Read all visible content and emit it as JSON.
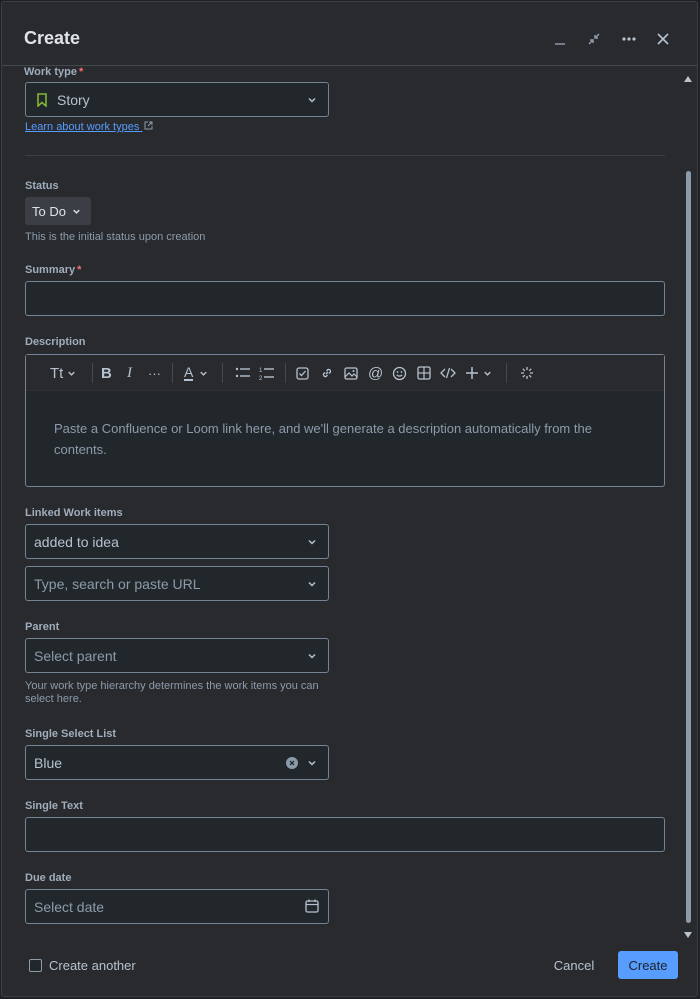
{
  "dialog": {
    "title": "Create",
    "header_icons": [
      "minimize-icon",
      "collapse-icon",
      "more-icon",
      "close-icon"
    ]
  },
  "work_type": {
    "label": "Work type",
    "required": "*",
    "value": "Story",
    "icon": "bookmark-icon",
    "icon_color": "#82b536",
    "learn_link": "Learn about work types"
  },
  "status": {
    "label": "Status",
    "value": "To Do",
    "helper": "This is the initial status upon creation"
  },
  "summary": {
    "label": "Summary",
    "required": "*",
    "value": ""
  },
  "description": {
    "label": "Description",
    "toolbar": {
      "text_style": "Tt",
      "more": "···",
      "text_color": "A"
    },
    "placeholder": "Paste a Confluence or Loom link here, and we'll generate a description automatically from the contents."
  },
  "linked_work_items": {
    "label": "Linked Work items",
    "relation": "added to idea",
    "search_placeholder": "Type, search or paste URL"
  },
  "parent": {
    "label": "Parent",
    "placeholder": "Select parent",
    "helper": "Your work type hierarchy determines the work items you can select here."
  },
  "single_select": {
    "label": "Single Select List",
    "value": "Blue"
  },
  "single_text": {
    "label": "Single Text",
    "value": ""
  },
  "due_date": {
    "label": "Due date",
    "placeholder": "Select date"
  },
  "footer": {
    "create_another": "Create another",
    "cancel": "Cancel",
    "create": "Create"
  },
  "colors": {
    "accent": "#579dff",
    "required": "#f87168"
  }
}
